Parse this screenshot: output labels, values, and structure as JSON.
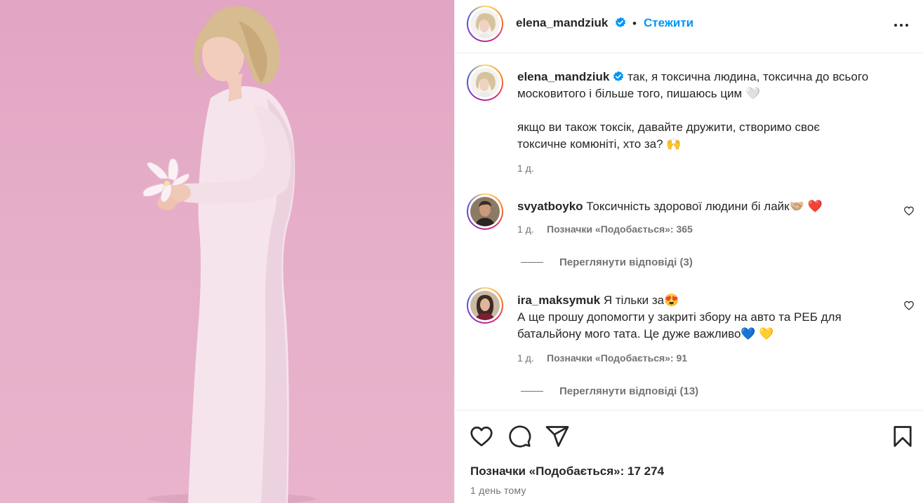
{
  "post": {
    "author": "elena_mandziuk",
    "follow_label": "Стежити",
    "separator": "•",
    "caption_line1": "так, я токсична людина, токсична до всього",
    "caption_line2": "московитого і більше того, пишаюсь цим 🤍",
    "caption_line3": "якщо ви також токсік, давайте дружити, створимо своє",
    "caption_line4": "токсичне комюніті, хто за? 🙌",
    "caption_age": "1 д.",
    "likes_label": "Позначки «Подобається»: 17 274",
    "posted_ago": "1 день тому"
  },
  "comments": [
    {
      "user": "svyatboyko",
      "text_line1": "Токсичність здорової людини бі лайк🤝🏼 ❤️",
      "age": "1 д.",
      "likes": "Позначки «Подобається»: 365",
      "view_replies": "Переглянути відповіді (3)"
    },
    {
      "user": "ira_maksymuk",
      "text_line1": "Я тільки за😍",
      "text_line2": "А ще прошу допомогти у закриті збору на авто та РЕБ для",
      "text_line3": "батальйону мого тата. Це дуже важливо💙 💛",
      "age": "1 д.",
      "likes": "Позначки «Подобається»: 91",
      "view_replies": "Переглянути відповіді (13)"
    }
  ],
  "colors": {
    "accent": "#0095f6",
    "verified": "#0095f6",
    "photo_bg": "#e6afc9"
  },
  "icons": [
    "verified-badge-icon",
    "more-options-icon",
    "heart-icon",
    "comment-icon",
    "share-icon",
    "bookmark-icon"
  ]
}
